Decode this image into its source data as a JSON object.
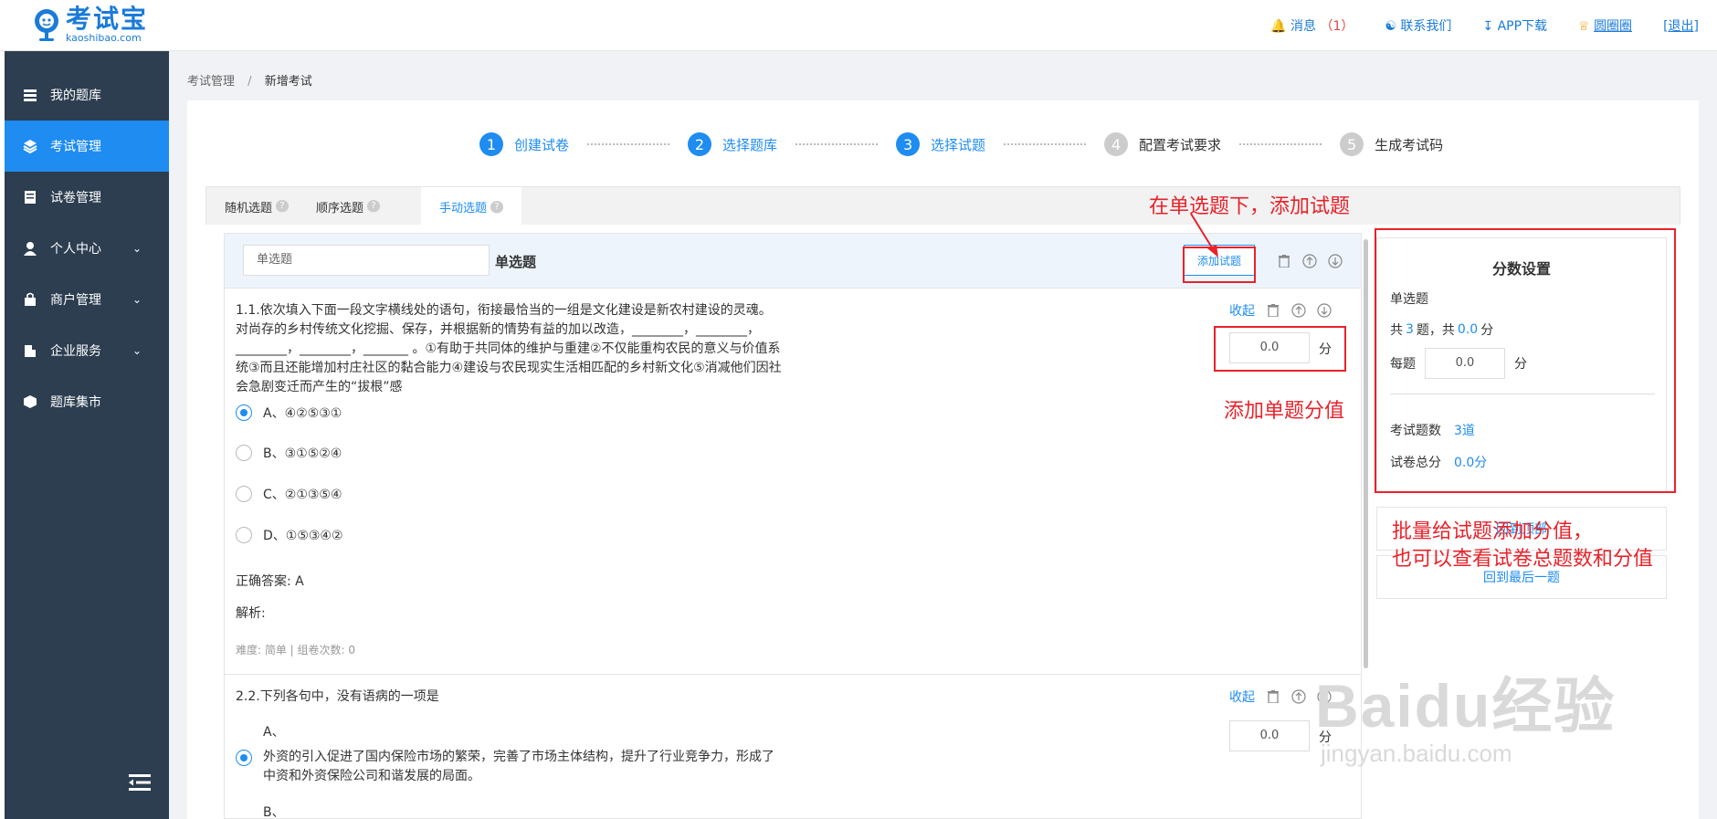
{
  "header": {
    "logo_name": "考试宝",
    "logo_url": "kaoshibao.com",
    "messages_label": "消息",
    "messages_count": "（1）",
    "contact_label": "联系我们",
    "app_label": "APP下载",
    "user_name": "圆圈圈",
    "logout_label": "[退出]"
  },
  "sidebar": {
    "items": [
      {
        "label": "我的题库",
        "icon": "list-icon"
      },
      {
        "label": "考试管理",
        "icon": "layers-icon",
        "active": true
      },
      {
        "label": "试卷管理",
        "icon": "document-icon"
      },
      {
        "label": "个人中心",
        "icon": "user-icon"
      },
      {
        "label": "商户管理",
        "icon": "bag-icon"
      },
      {
        "label": "企业服务",
        "icon": "building-icon"
      },
      {
        "label": "题库集市",
        "icon": "box-icon"
      }
    ]
  },
  "breadcrumb": {
    "parent": "考试管理",
    "sep": "/",
    "current": "新增考试"
  },
  "steps": [
    {
      "num": "1",
      "label": "创建试卷"
    },
    {
      "num": "2",
      "label": "选择题库"
    },
    {
      "num": "3",
      "label": "选择试题"
    },
    {
      "num": "4",
      "label": "配置考试要求"
    },
    {
      "num": "5",
      "label": "生成考试码"
    }
  ],
  "tabs": [
    {
      "label": "随机选题"
    },
    {
      "label": "顺序选题"
    },
    {
      "label": "手动选题",
      "active": true
    }
  ],
  "section": {
    "type_input": "单选题",
    "type_title": "单选题",
    "add_button": "添加试题"
  },
  "questions": [
    {
      "collapse_label": "收起",
      "text": "1.1.依次填入下面一段文字横线处的语句，衔接最恰当的一组是文化建设是新农村建设的灵魂。对尚存的乡村传统文化挖掘、保存，并根据新的情势有益的加以改造，________，________，________，________，_______ 。①有助于共同体的维护与重建②不仅能重构农民的意义与价值系统③而且还能增加村庄社区的黏合能力④建设与农民现实生活相匹配的乡村新文化⑤消减他们因社会急剧变迁而产生的“拔根”感",
      "options": [
        "A、④②⑤③①",
        "B、③①⑤②④",
        "C、②①③⑤④",
        "D、①⑤③④②"
      ],
      "answer": "正确答案: A",
      "analysis": "解析:",
      "meta": "难度: 简单   |  组卷次数: 0",
      "score": "0.0",
      "unit": "分"
    },
    {
      "collapse_label": "收起",
      "text": "2.2.下列各句中，没有语病的一项是",
      "option_a_label": "A、",
      "option_a_text": "外资的引入促进了国内保险市场的繁荣，完善了市场主体结构，提升了行业竞争力，形成了中资和外资保险公司和谐发展的局面。",
      "option_b_label": "B、",
      "score": "0.0",
      "unit": "分"
    }
  ],
  "score_panel": {
    "title": "分数设置",
    "type": "单选题",
    "total_prefix": "共",
    "total_count": "3",
    "total_mid": "题，共",
    "total_score": "0.0",
    "total_suffix": "分",
    "per_label": "每题",
    "per_value": "0.0",
    "per_unit": "分",
    "count_label": "考试题数",
    "count_value": "3道",
    "sum_label": "试卷总分",
    "sum_value": "0.0分",
    "top_button": "回到顶部",
    "last_button": "回到最后一题"
  },
  "annotations": {
    "add_question": "在单选题下，添加试题",
    "add_score": "添加单题分值",
    "batch_line1": "批量给试题添加分值，",
    "batch_line2": "也可以查看试卷总题数和分值",
    "color": "#e8222a"
  },
  "watermark": {
    "big": "Baidu经验",
    "small": "jingyan.baidu.com"
  }
}
